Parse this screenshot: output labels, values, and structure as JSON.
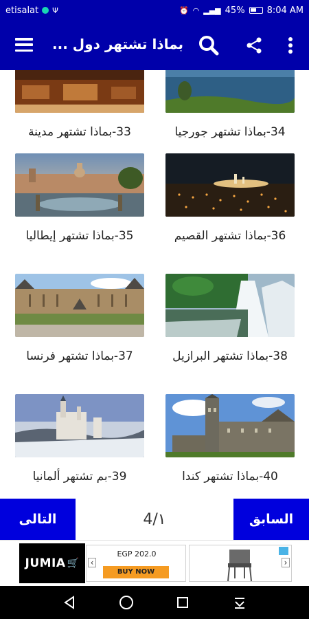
{
  "status_bar": {
    "carrier": "etisalat",
    "battery": "45%",
    "time": "8:04 AM"
  },
  "app_bar": {
    "title": "بماذا تشتهر دول ..."
  },
  "items": [
    {
      "caption": "33-بماذا تشتهر مدينة"
    },
    {
      "caption": "34-بماذا تشتهر جورجيا"
    },
    {
      "caption": "35-بماذا تشتهر إيطاليا"
    },
    {
      "caption": "36-بماذا تشتهر القصيم"
    },
    {
      "caption": "37-بماذا تشتهر فرنسا"
    },
    {
      "caption": "38-بماذا تشتهر البرازيل"
    },
    {
      "caption": "39-بم تشتهر ألمانيا"
    },
    {
      "caption": "40-بماذا تشتهر كندا"
    }
  ],
  "pager": {
    "next_label": "التالى",
    "prev_label": "السابق",
    "page_indicator": "4/١"
  },
  "ad": {
    "brand": "JUMIA",
    "price": "EGP 202.0",
    "buy_label": "BUY NOW"
  },
  "colors": {
    "primary": "#0000aa",
    "button": "#0000dd",
    "accent_ad": "#f59b22"
  }
}
